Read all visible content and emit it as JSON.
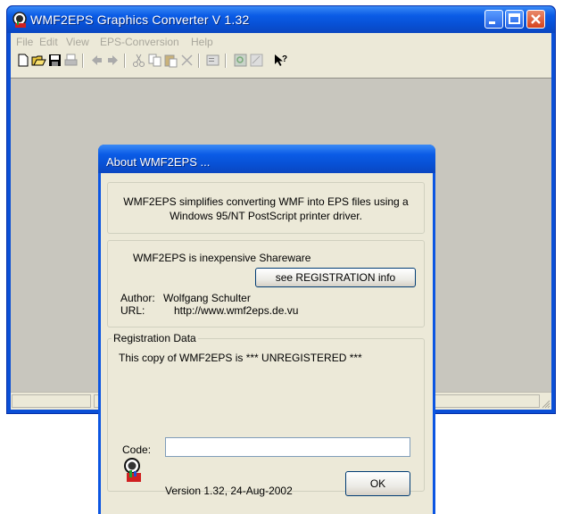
{
  "main_window": {
    "title": "WMF2EPS Graphics Converter V 1.32",
    "menu": [
      "File",
      "Edit",
      "View",
      "EPS-Conversion",
      "Help"
    ],
    "toolbar_icons": [
      "new-file-icon",
      "open-folder-icon",
      "save-icon",
      "print-icon",
      "back-arrow-icon",
      "forward-arrow-icon",
      "cut-icon",
      "copy-icon",
      "paste-icon",
      "delete-icon",
      "properties-icon",
      "zoom-in-icon",
      "zoom-out-icon",
      "context-help-icon"
    ]
  },
  "about_dialog": {
    "title": "About WMF2EPS ...",
    "description": "WMF2EPS simplifies converting WMF into EPS files using a Windows 95/NT PostScript printer driver.",
    "shareware_text": "WMF2EPS is inexpensive Shareware",
    "registration_info_button": "see REGISTRATION info",
    "author_label": "Author:",
    "author_value": "Wolfgang Schulter",
    "url_label": "URL:",
    "url_value": "http://www.wmf2eps.de.vu",
    "registration_group_label": "Registration Data",
    "registration_status": "This copy of WMF2EPS is *** UNREGISTERED ***",
    "code_label": "Code:",
    "code_value": "",
    "version_text": "Version 1.32, 24-Aug-2002",
    "ok_button": "OK"
  },
  "colors": {
    "titlebar_blue": "#0a5be6",
    "dialog_face": "#ece9d8",
    "workspace_gray": "#c8c6be",
    "close_red": "#d6431f"
  }
}
